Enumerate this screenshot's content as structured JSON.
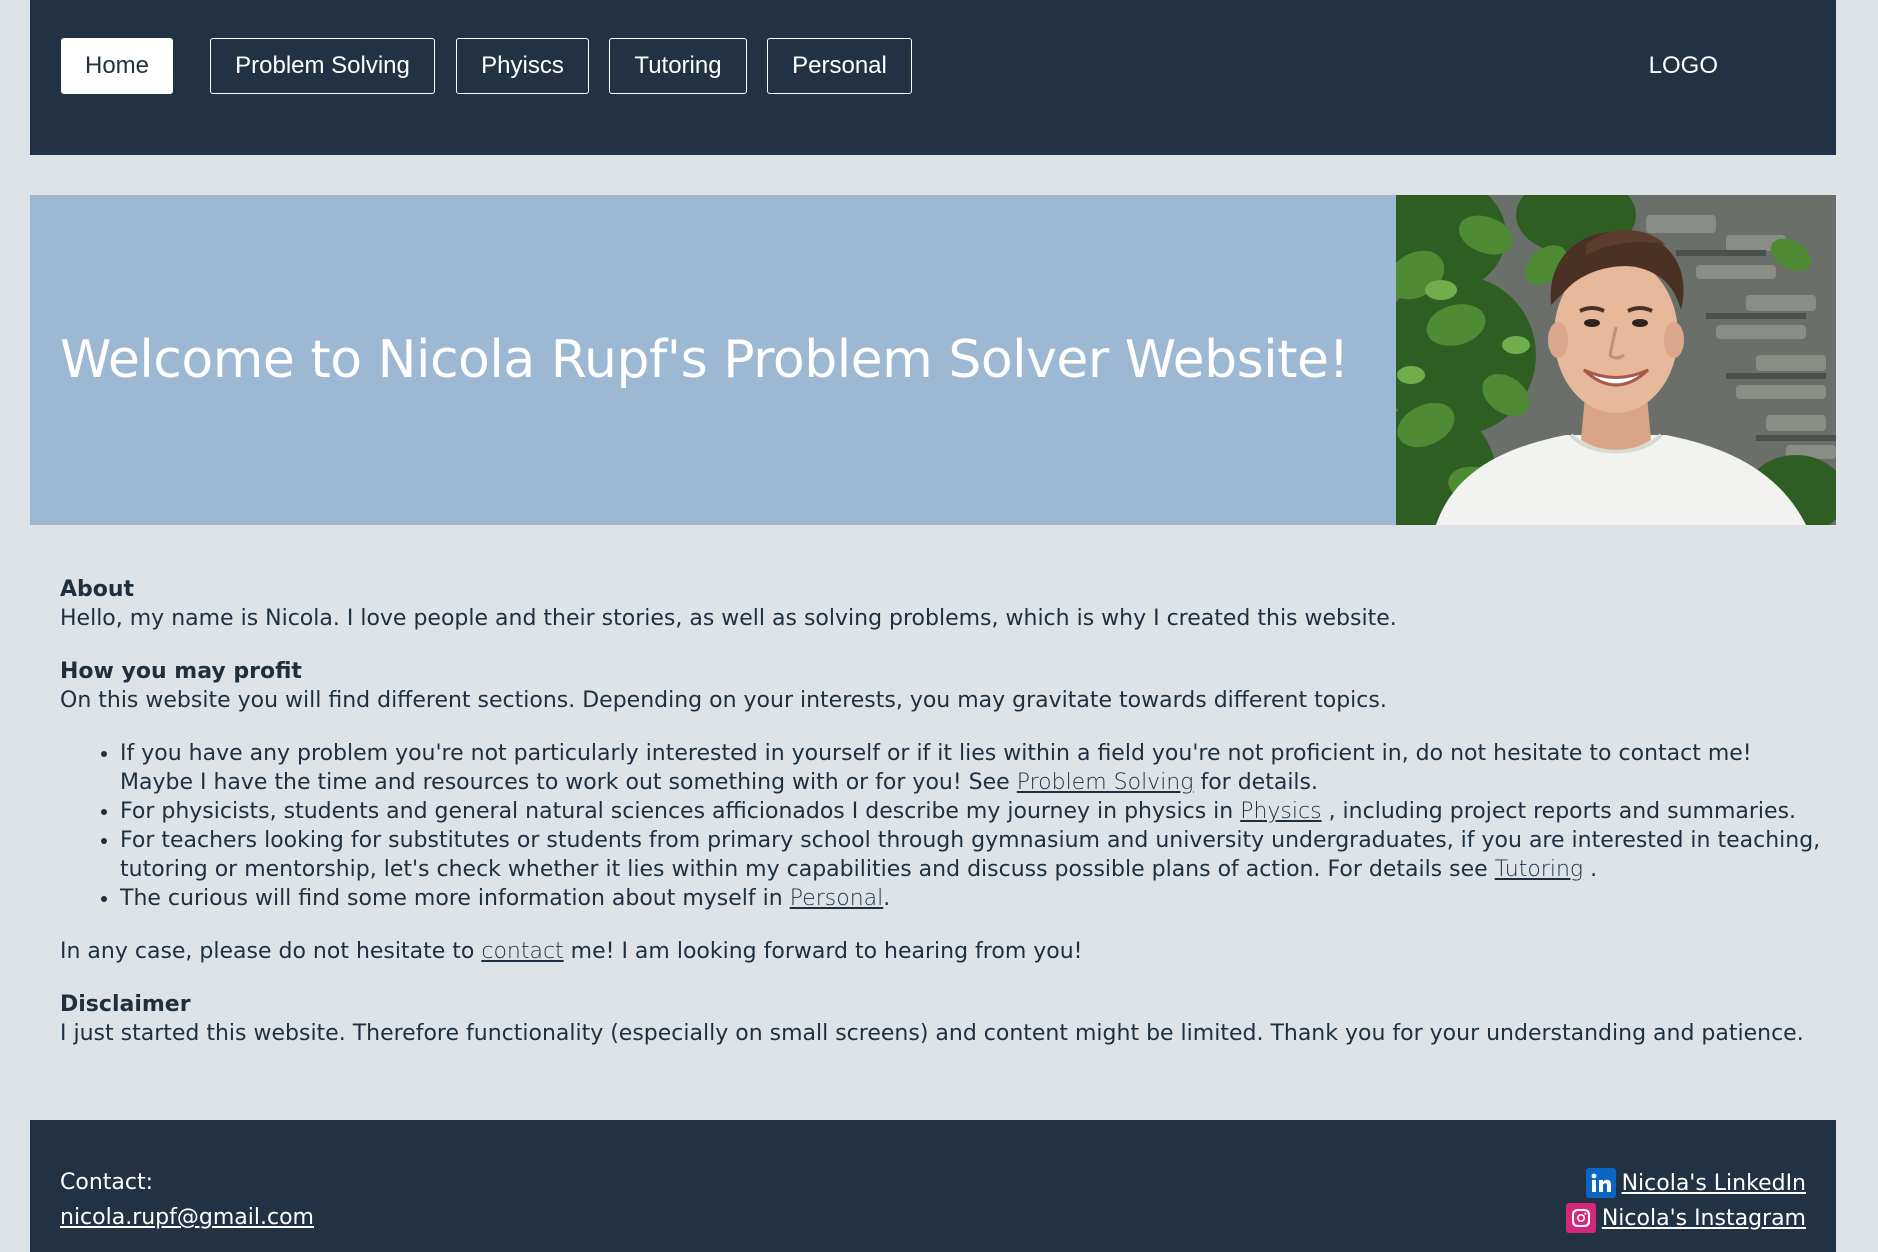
{
  "nav": {
    "items": [
      {
        "label": "Home",
        "active": true
      },
      {
        "label": "Problem Solving",
        "active": false
      },
      {
        "label": "Phyiscs",
        "active": false
      },
      {
        "label": "Tutoring",
        "active": false
      },
      {
        "label": "Personal",
        "active": false
      }
    ],
    "logo": "LOGO"
  },
  "hero": {
    "title": "Welcome to Nicola Rupf's Problem Solver Website!",
    "photo": "portrait-photo"
  },
  "content": {
    "about_heading": "About",
    "about_text": "Hello, my name is Nicola. I love people and their stories, as well as solving problems, which is why I created this website.",
    "profit_heading": "How you may profit",
    "profit_text": "On this website you will find different sections. Depending on your interests, you may gravitate towards different topics.",
    "bullets": [
      {
        "pre": "If you have any problem you're not particularly interested in yourself or if it lies within a field you're not proficient in, do not hesitate to contact me! Maybe I have the time and resources to work out something with or for you! See ",
        "link": "Problem Solving",
        "post": " for details."
      },
      {
        "pre": "For physicists, students and general natural sciences afficionados I describe my journey in physics in ",
        "link": "Physics",
        "post": " , including project reports and summaries."
      },
      {
        "pre": "For teachers looking for substitutes or students from primary school through gymnasium and university undergraduates, if you are interested in teaching, tutoring or mentorship, let's check whether it lies within my capabilities and discuss possible plans of action. For details see ",
        "link": "Tutoring",
        "post": " ."
      },
      {
        "pre": "The curious will find some more information about myself in ",
        "link": "Personal",
        "post": "."
      }
    ],
    "contact_pre": "In any case, please do not hesitate to ",
    "contact_link": "contact",
    "contact_post": " me! I am looking forward to hearing from you!",
    "disclaimer_heading": "Disclaimer",
    "disclaimer_text": "I just started this website. Therefore functionality (especially on small screens) and content might be limited. Thank you for your understanding and patience."
  },
  "footer": {
    "contact_label": "Contact:",
    "email": "nicola.rupf@gmail.com",
    "linkedin": "Nicola's LinkedIn",
    "instagram": "Nicola's Instagram"
  },
  "colors": {
    "navy": "#213244",
    "hero_bg": "#9db8d2",
    "page_bg": "#dde3e7",
    "linkedin": "#0a66c2",
    "instagram": "#d6287a"
  }
}
